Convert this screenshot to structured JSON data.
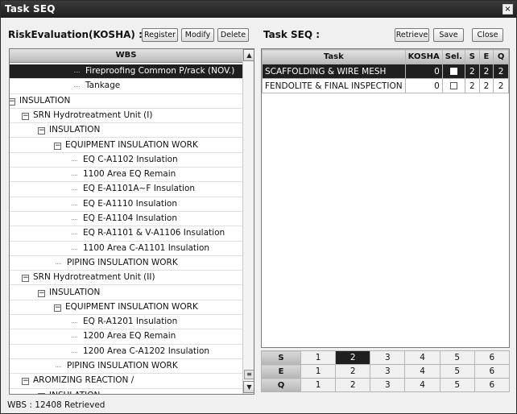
{
  "window": {
    "title": "Task SEQ",
    "close_glyph": "×"
  },
  "left_toolbar": {
    "label": "RiskEvaluation(KOSHA) :",
    "buttons": [
      {
        "label": "Register"
      },
      {
        "label": "Modify"
      },
      {
        "label": "Delete"
      }
    ]
  },
  "right_toolbar": {
    "label": "Task SEQ :",
    "buttons": [
      {
        "label": "Retrieve"
      },
      {
        "label": "Save"
      },
      {
        "label": "Close"
      }
    ]
  },
  "wbs_tree": {
    "header": "WBS",
    "rows": [
      {
        "text": "Fireproofing Common P/rack (NOV.)",
        "selected": true
      },
      {
        "text": "Tankage"
      },
      {
        "text": "INSULATION",
        "toggle": "minus"
      },
      {
        "text": "SRN Hydrotreatment Unit (I)",
        "toggle": "minus"
      },
      {
        "text": "INSULATION",
        "toggle": "minus"
      },
      {
        "text": "EQUIPMENT INSULATION WORK",
        "toggle": "minus"
      },
      {
        "text": "EQ C-A1102 Insulation"
      },
      {
        "text": "1100 Area EQ Remain"
      },
      {
        "text": "EQ E-A1101A~F Insulation"
      },
      {
        "text": "EQ E-A1110 Insulation"
      },
      {
        "text": "EQ E-A1104 Insulation"
      },
      {
        "text": "EQ R-A1101 & V-A1106 Insulation"
      },
      {
        "text": "1100 Area C-A1101 Insulation"
      },
      {
        "text": "PIPING INSULATION WORK"
      },
      {
        "text": "SRN Hydrotreatment Unit (II)",
        "toggle": "minus"
      },
      {
        "text": "INSULATION",
        "toggle": "minus"
      },
      {
        "text": "EQUIPMENT INSULATION WORK",
        "toggle": "minus"
      },
      {
        "text": "EQ R-A1201 Insulation"
      },
      {
        "text": "1200 Area EQ Remain"
      },
      {
        "text": "1200 Area C-A1202 Insulation"
      },
      {
        "text": "PIPING INSULATION WORK"
      },
      {
        "text": "AROMIZING REACTION /",
        "toggle": "minus"
      },
      {
        "text": "INSULATION",
        "toggle": "minus"
      }
    ],
    "scroll_up_glyph": "▲",
    "scroll_down_glyph": "▼",
    "scroll_grip_glyph": "≡"
  },
  "task_grid": {
    "columns": [
      "Task",
      "KOSHA",
      "Sel.",
      "S",
      "E",
      "Q"
    ],
    "rows": [
      {
        "task": "SCAFFOLDING & WIRE MESH",
        "kosha": "0",
        "sel": true,
        "s": "2",
        "e": "2",
        "q": "2",
        "selected": true
      },
      {
        "task": "FENDOLITE & FINAL INSPECTION",
        "kosha": "0",
        "sel": false,
        "s": "2",
        "e": "2",
        "q": "2"
      }
    ]
  },
  "rating_legend": {
    "rows": [
      {
        "label": "S",
        "values": [
          "1",
          "2",
          "3",
          "4",
          "5",
          "6"
        ],
        "selected": "2"
      },
      {
        "label": "E",
        "values": [
          "1",
          "2",
          "3",
          "4",
          "5",
          "6"
        ]
      },
      {
        "label": "Q",
        "values": [
          "1",
          "2",
          "3",
          "4",
          "5",
          "6"
        ]
      }
    ]
  },
  "status_bar": {
    "text": "WBS : 12408 Retrieved"
  },
  "colors": {
    "title_bar": "#1e1e1e",
    "selection": "#1f1f1f",
    "header_gray": "#c4c4c4"
  }
}
